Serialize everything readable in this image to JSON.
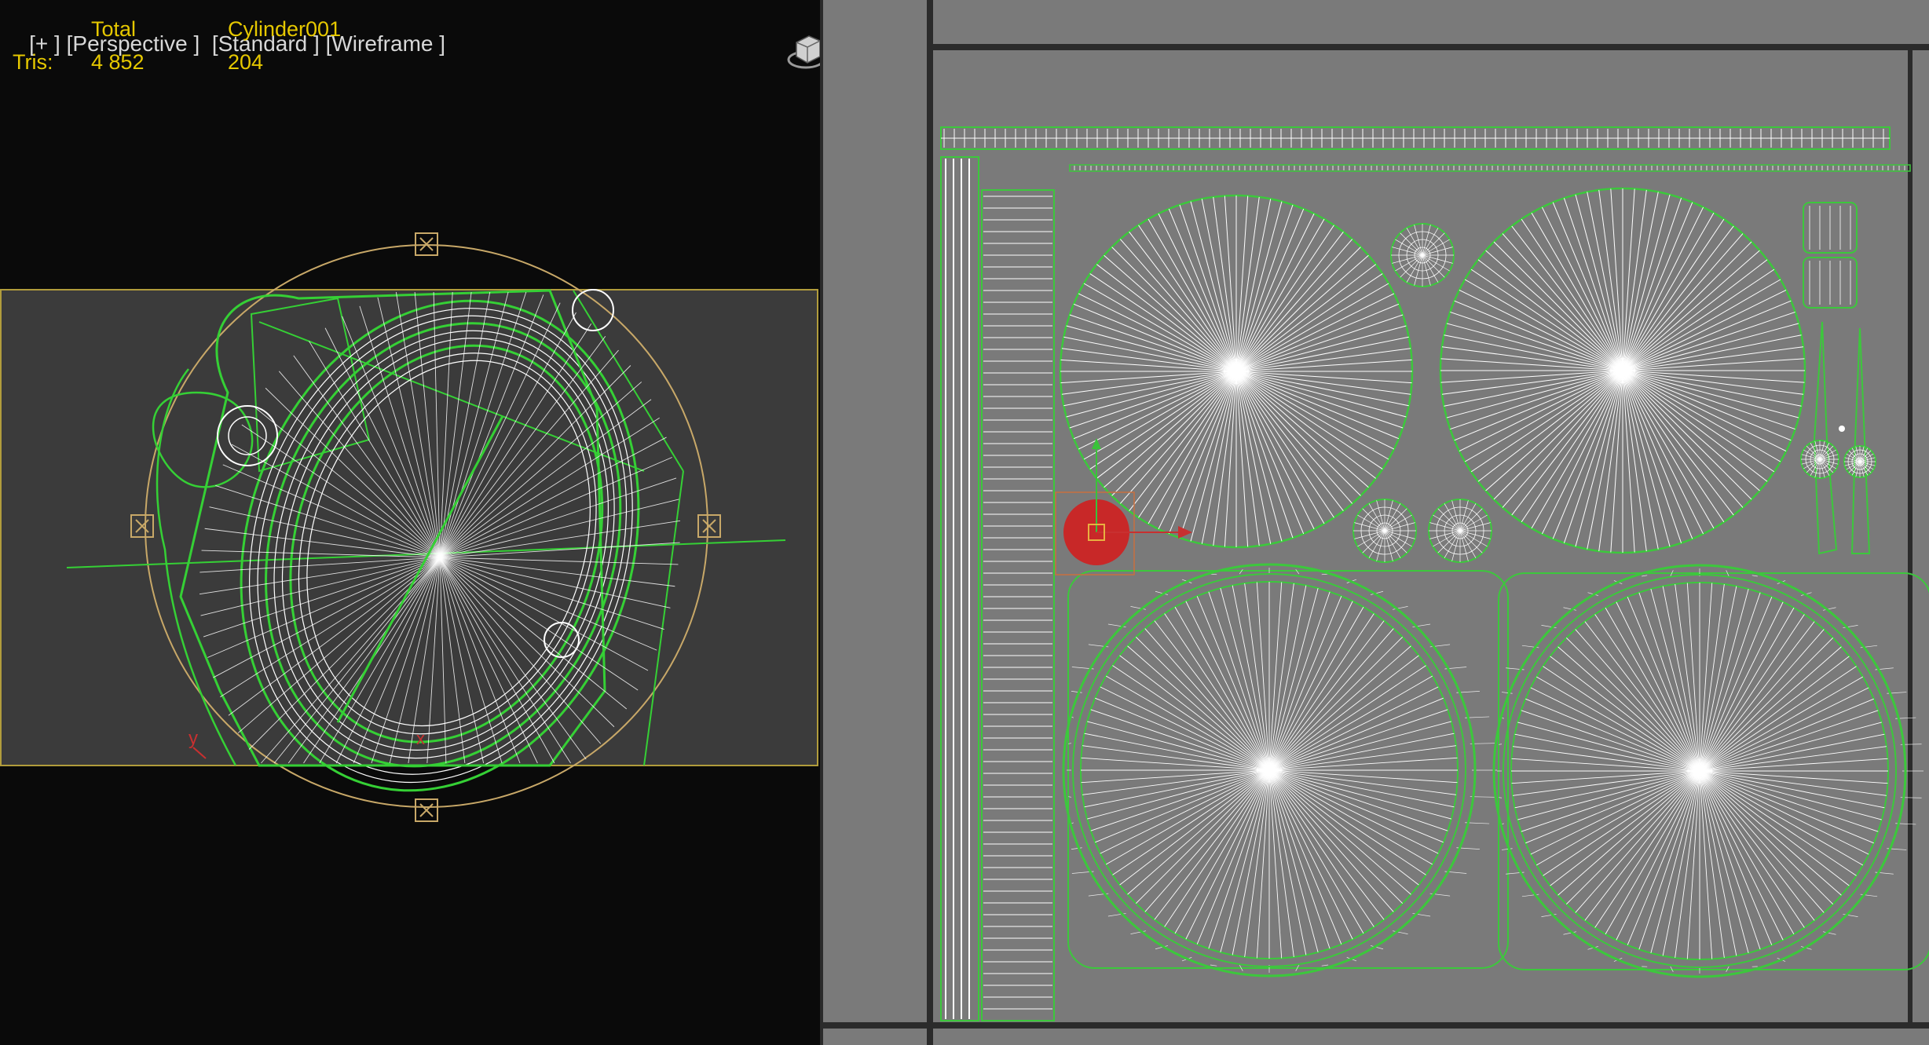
{
  "viewport": {
    "labels": {
      "plus": "[+ ]",
      "view": "[Perspective ]",
      "shading": "[Standard ]",
      "mode": "[Wireframe ]"
    },
    "stats": {
      "col_total": "Total",
      "col_object": "Cylinder001",
      "row_label": "Tris:",
      "total_value": "4 852",
      "object_value": "204"
    },
    "axis_labels": {
      "y": "y",
      "x": "x"
    },
    "icons": [
      "viewcube-icon",
      "selection-bracket-icon",
      "axis-tripod-icon"
    ]
  },
  "uv_editor": {
    "icons": [
      "move-gizmo-icon",
      "uv-shell-icon"
    ]
  },
  "colors": {
    "viewport_bg": "#0a0a0a",
    "viewport_frame": "#b19c3c",
    "wire_green": "#35d035",
    "wire_white": "#ffffff",
    "gizmo_ring": "#c8a868",
    "stat_text": "#e6c800",
    "uv_bg": "#7a7a7a",
    "uv_border": "#2b2b2b",
    "uv_green": "#3cc83c",
    "uv_selected": "#c82828"
  }
}
